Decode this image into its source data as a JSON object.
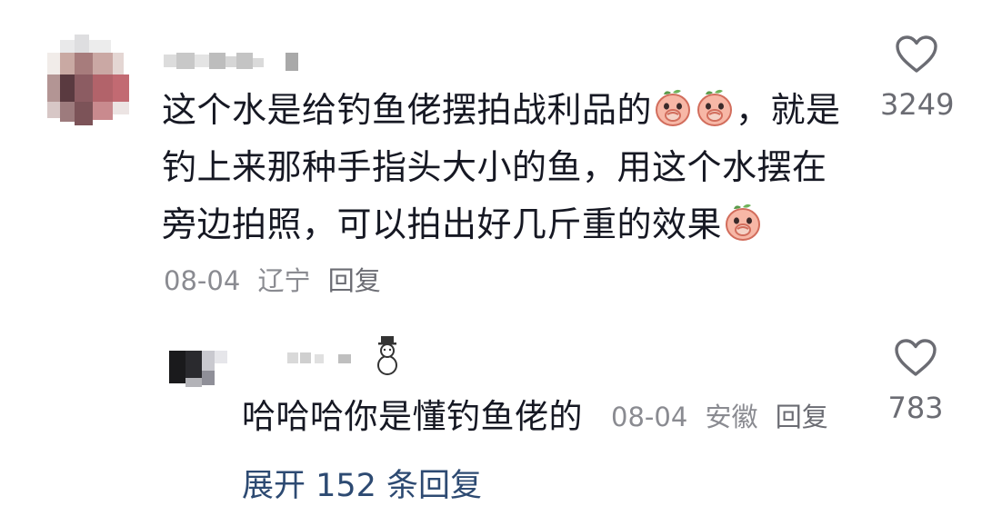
{
  "comment": {
    "text_parts": [
      "这个水是给钓鱼佬摆拍战利品的",
      "，就是钓上来那种手指头大小的鱼，用这个水摆在旁边拍照，可以拍出好几斤重的效果"
    ],
    "date": "08-04",
    "location": "辽宁",
    "reply_label": "回复",
    "likes": "3249",
    "emoji_icon": "peach-cover-mouth-emoji"
  },
  "reply": {
    "text": "哈哈哈你是懂钓鱼佬的",
    "date": "08-04",
    "location": "安徽",
    "reply_label": "回复",
    "likes": "783",
    "name_icon": "snowman-icon"
  },
  "expand": {
    "label": "展开 152 条回复"
  },
  "colors": {
    "text": "#161823",
    "meta": "#8a8b91",
    "link": "#2d4a72",
    "heart": "#6b6c73"
  }
}
